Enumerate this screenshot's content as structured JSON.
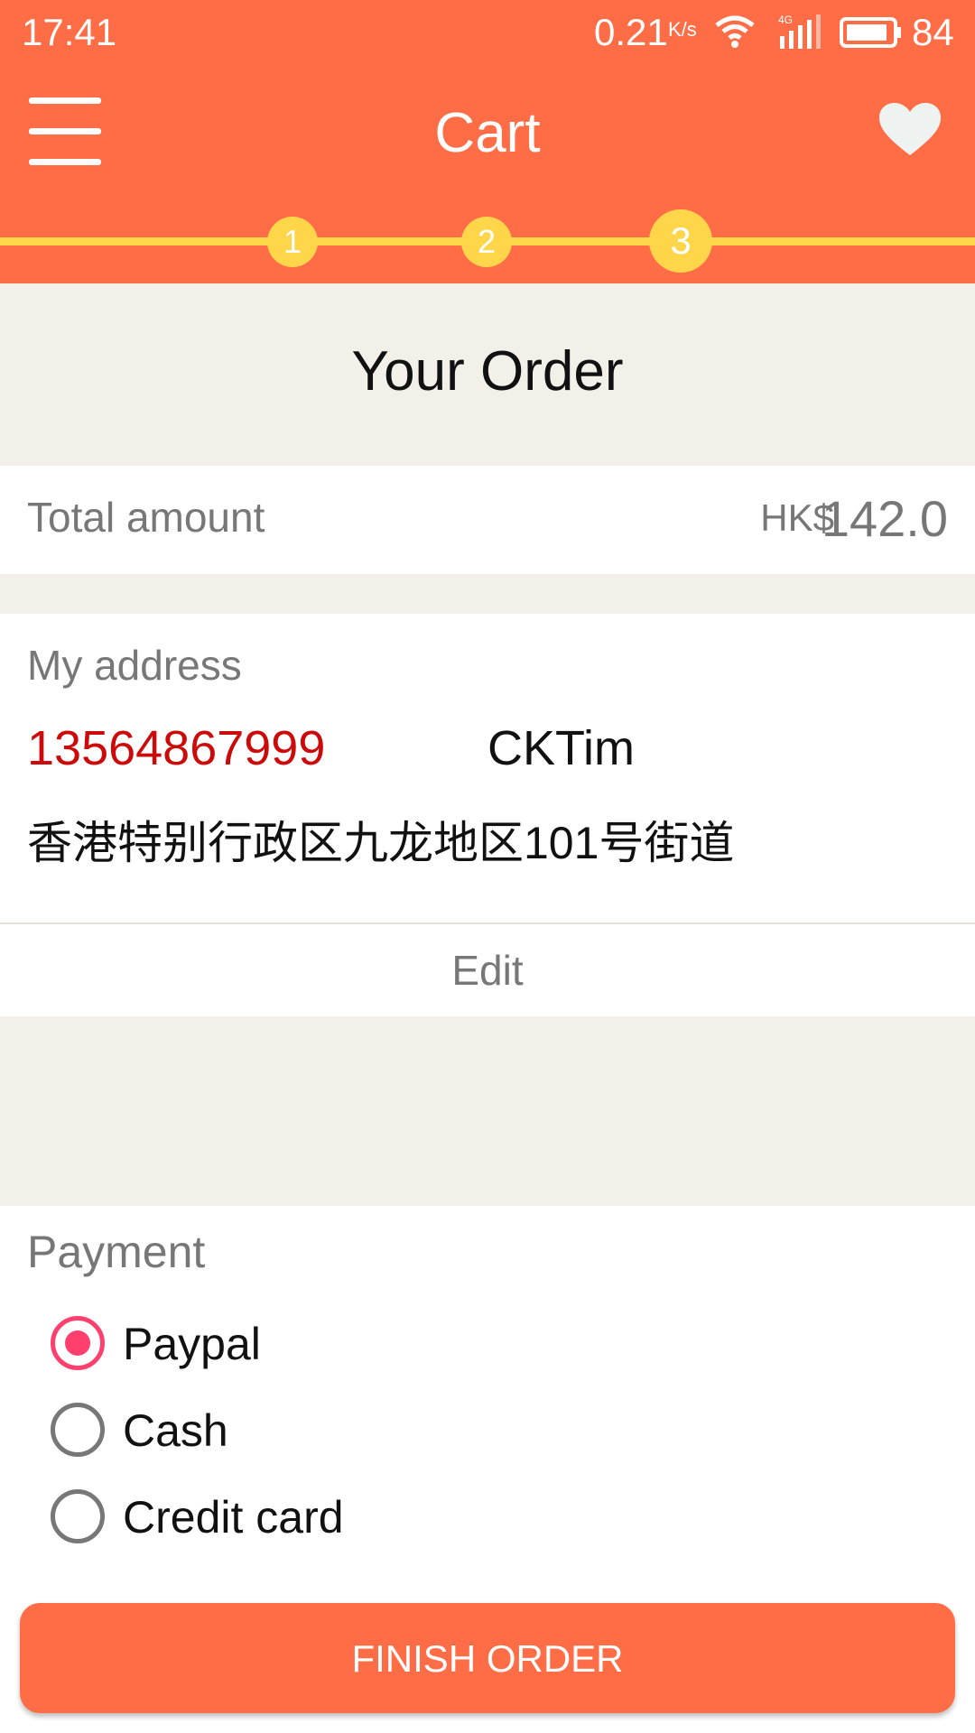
{
  "status_bar": {
    "time": "17:41",
    "speed": "0.21",
    "speed_unit": "K/s",
    "network": "4G",
    "battery": "84"
  },
  "header": {
    "title": "Cart",
    "menu_icon": "hamburger-menu-icon",
    "favorite_icon": "heart-icon",
    "steps": [
      "1",
      "2",
      "3"
    ],
    "active_step": 3
  },
  "order": {
    "title": "Your Order",
    "total_label": "Total amount",
    "currency": "HK$",
    "total_value": "142.0"
  },
  "address": {
    "label": "My address",
    "phone": "13564867999",
    "name": "CKTim",
    "street": "香港特别行政区九龙地区101号街道",
    "edit_label": "Edit"
  },
  "payment": {
    "label": "Payment",
    "options": [
      {
        "label": "Paypal",
        "selected": true
      },
      {
        "label": "Cash",
        "selected": false
      },
      {
        "label": "Credit card",
        "selected": false
      }
    ]
  },
  "finish_button": "FINISH ORDER",
  "colors": {
    "primary": "#ff6d47",
    "step": "#ffd54a",
    "radio_selected": "#ff3f6e",
    "phone": "#cc0a0a",
    "background": "#f3efe9"
  }
}
